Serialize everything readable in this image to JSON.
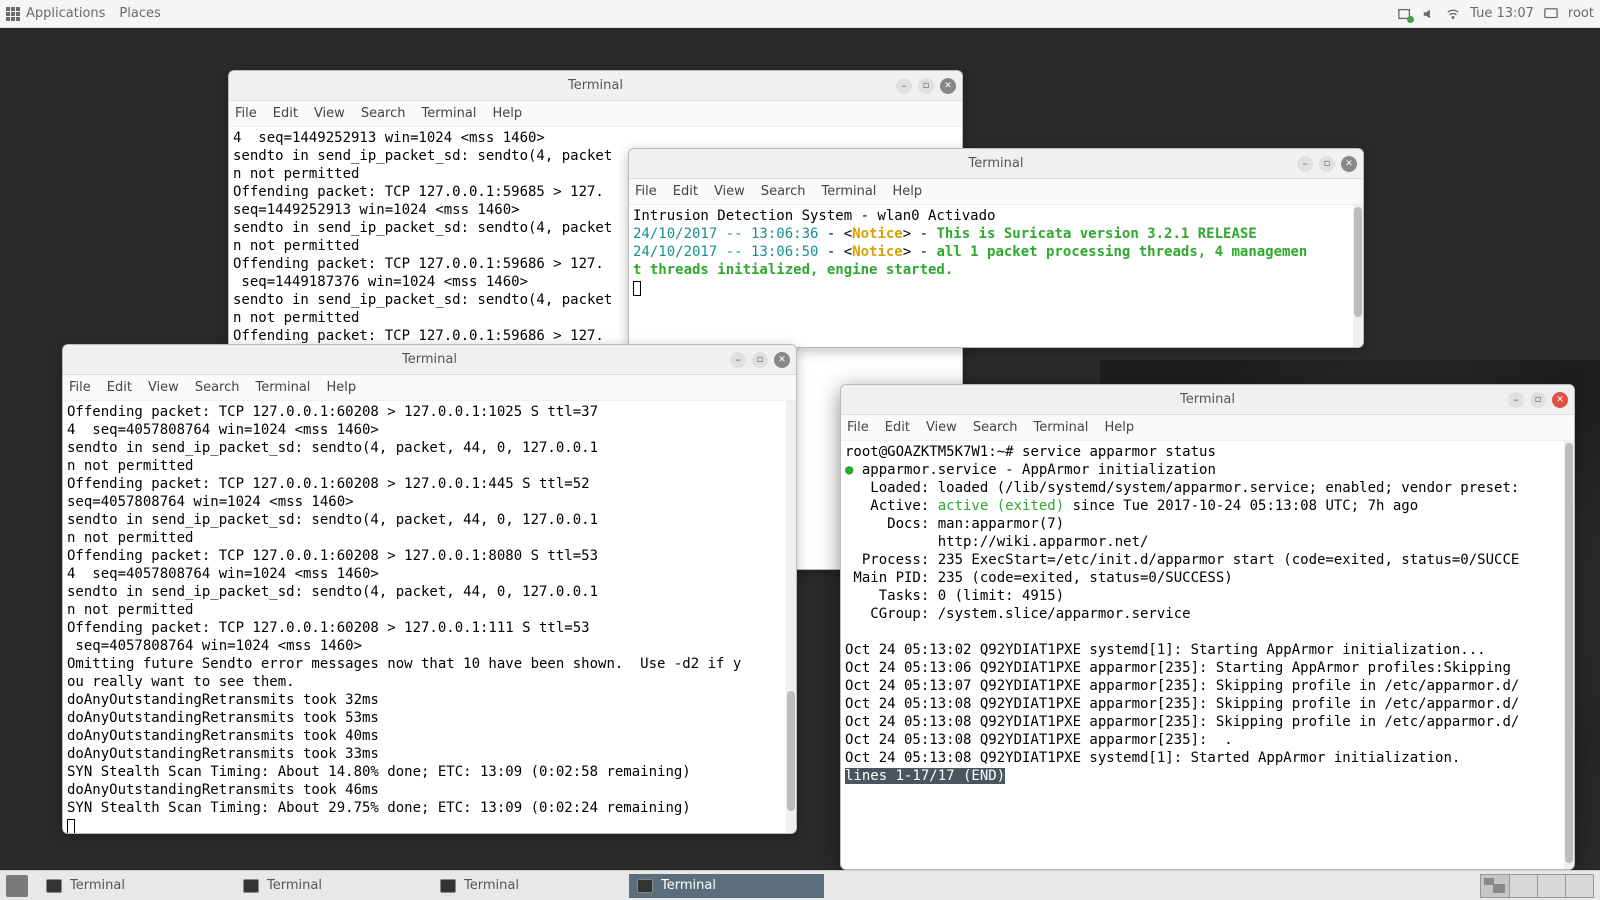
{
  "top_panel": {
    "applications": "Applications",
    "places": "Places",
    "clock": "Tue 13:07",
    "user": "root"
  },
  "menus": {
    "file": "File",
    "edit": "Edit",
    "view": "View",
    "search": "Search",
    "terminal": "Terminal",
    "help": "Help"
  },
  "term1": {
    "title": "Terminal",
    "content": "4  seq=1449252913 win=1024 <mss 1460>\nsendto in send_ip_packet_sd: sendto(4, packet\nn not permitted\nOffending packet: TCP 127.0.0.1:59685 > 127.\nseq=1449252913 win=1024 <mss 1460>\nsendto in send_ip_packet_sd: sendto(4, packet\nn not permitted\nOffending packet: TCP 127.0.0.1:59686 > 127.\n seq=1449187376 win=1024 <mss 1460>\nsendto in send_ip_packet_sd: sendto(4, packet\nn not permitted\nOffending packet: TCP 127.0.0.1:59686 > 127."
  },
  "term2": {
    "title": "Terminal",
    "line1": "Intrusion Detection System - wlan0 Activado",
    "ts1": "24/10/2017 -- 13:06:36",
    "ts2": "24/10/2017 -- 13:06:50",
    "notice": "Notice",
    "msg1": "This is Suricata version 3.2.1 RELEASE",
    "msg2a": "all 1 packet processing threads, 4 managemen",
    "msg2b": "t threads initialized, engine started."
  },
  "term3": {
    "title": "Terminal",
    "content": "Offending packet: TCP 127.0.0.1:60208 > 127.0.0.1:1025 S ttl=37\n4  seq=4057808764 win=1024 <mss 1460>\nsendto in send_ip_packet_sd: sendto(4, packet, 44, 0, 127.0.0.1\nn not permitted\nOffending packet: TCP 127.0.0.1:60208 > 127.0.0.1:445 S ttl=52\nseq=4057808764 win=1024 <mss 1460>\nsendto in send_ip_packet_sd: sendto(4, packet, 44, 0, 127.0.0.1\nn not permitted\nOffending packet: TCP 127.0.0.1:60208 > 127.0.0.1:8080 S ttl=53\n4  seq=4057808764 win=1024 <mss 1460>\nsendto in send_ip_packet_sd: sendto(4, packet, 44, 0, 127.0.0.1\nn not permitted\nOffending packet: TCP 127.0.0.1:60208 > 127.0.0.1:111 S ttl=53\n seq=4057808764 win=1024 <mss 1460>\nOmitting future Sendto error messages now that 10 have been shown.  Use -d2 if y\nou really want to see them.\ndoAnyOutstandingRetransmits took 32ms\ndoAnyOutstandingRetransmits took 53ms\ndoAnyOutstandingRetransmits took 40ms\ndoAnyOutstandingRetransmits took 33ms\nSYN Stealth Scan Timing: About 14.80% done; ETC: 13:09 (0:02:58 remaining)\ndoAnyOutstandingRetransmits took 46ms\nSYN Stealth Scan Timing: About 29.75% done; ETC: 13:09 (0:02:24 remaining)"
  },
  "term4": {
    "title": "Terminal",
    "prompt": "root@GOAZKTM5K7W1:~# ",
    "cmd": "service apparmor status",
    "svc_line": "apparmor.service - AppArmor initialization",
    "loaded": "   Loaded: loaded (/lib/systemd/system/apparmor.service; enabled; vendor preset:",
    "active_pre": "   Active: ",
    "active_val": "active (exited)",
    "active_post": " since Tue 2017-10-24 05:13:08 UTC; 7h ago",
    "docs1": "     Docs: man:apparmor(7)",
    "docs2": "           http://wiki.apparmor.net/",
    "process": "  Process: 235 ExecStart=/etc/init.d/apparmor start (code=exited, status=0/SUCCE",
    "mainpid": " Main PID: 235 (code=exited, status=0/SUCCESS)",
    "tasks": "    Tasks: 0 (limit: 4915)",
    "cgroup": "   CGroup: /system.slice/apparmor.service",
    "log1": "Oct 24 05:13:02 Q92YDIAT1PXE systemd[1]: Starting AppArmor initialization...",
    "log2": "Oct 24 05:13:06 Q92YDIAT1PXE apparmor[235]: Starting AppArmor profiles:Skipping",
    "log3": "Oct 24 05:13:07 Q92YDIAT1PXE apparmor[235]: Skipping profile in /etc/apparmor.d/",
    "log4": "Oct 24 05:13:08 Q92YDIAT1PXE apparmor[235]: Skipping profile in /etc/apparmor.d/",
    "log5": "Oct 24 05:13:08 Q92YDIAT1PXE apparmor[235]: Skipping profile in /etc/apparmor.d/",
    "log6": "Oct 24 05:13:08 Q92YDIAT1PXE apparmor[235]:  .",
    "log7": "Oct 24 05:13:08 Q92YDIAT1PXE systemd[1]: Started AppArmor initialization.",
    "pager": "lines 1-17/17 (END)"
  },
  "taskbar": {
    "t1": "Terminal",
    "t2": "Terminal",
    "t3": "Terminal",
    "t4": "Terminal"
  }
}
